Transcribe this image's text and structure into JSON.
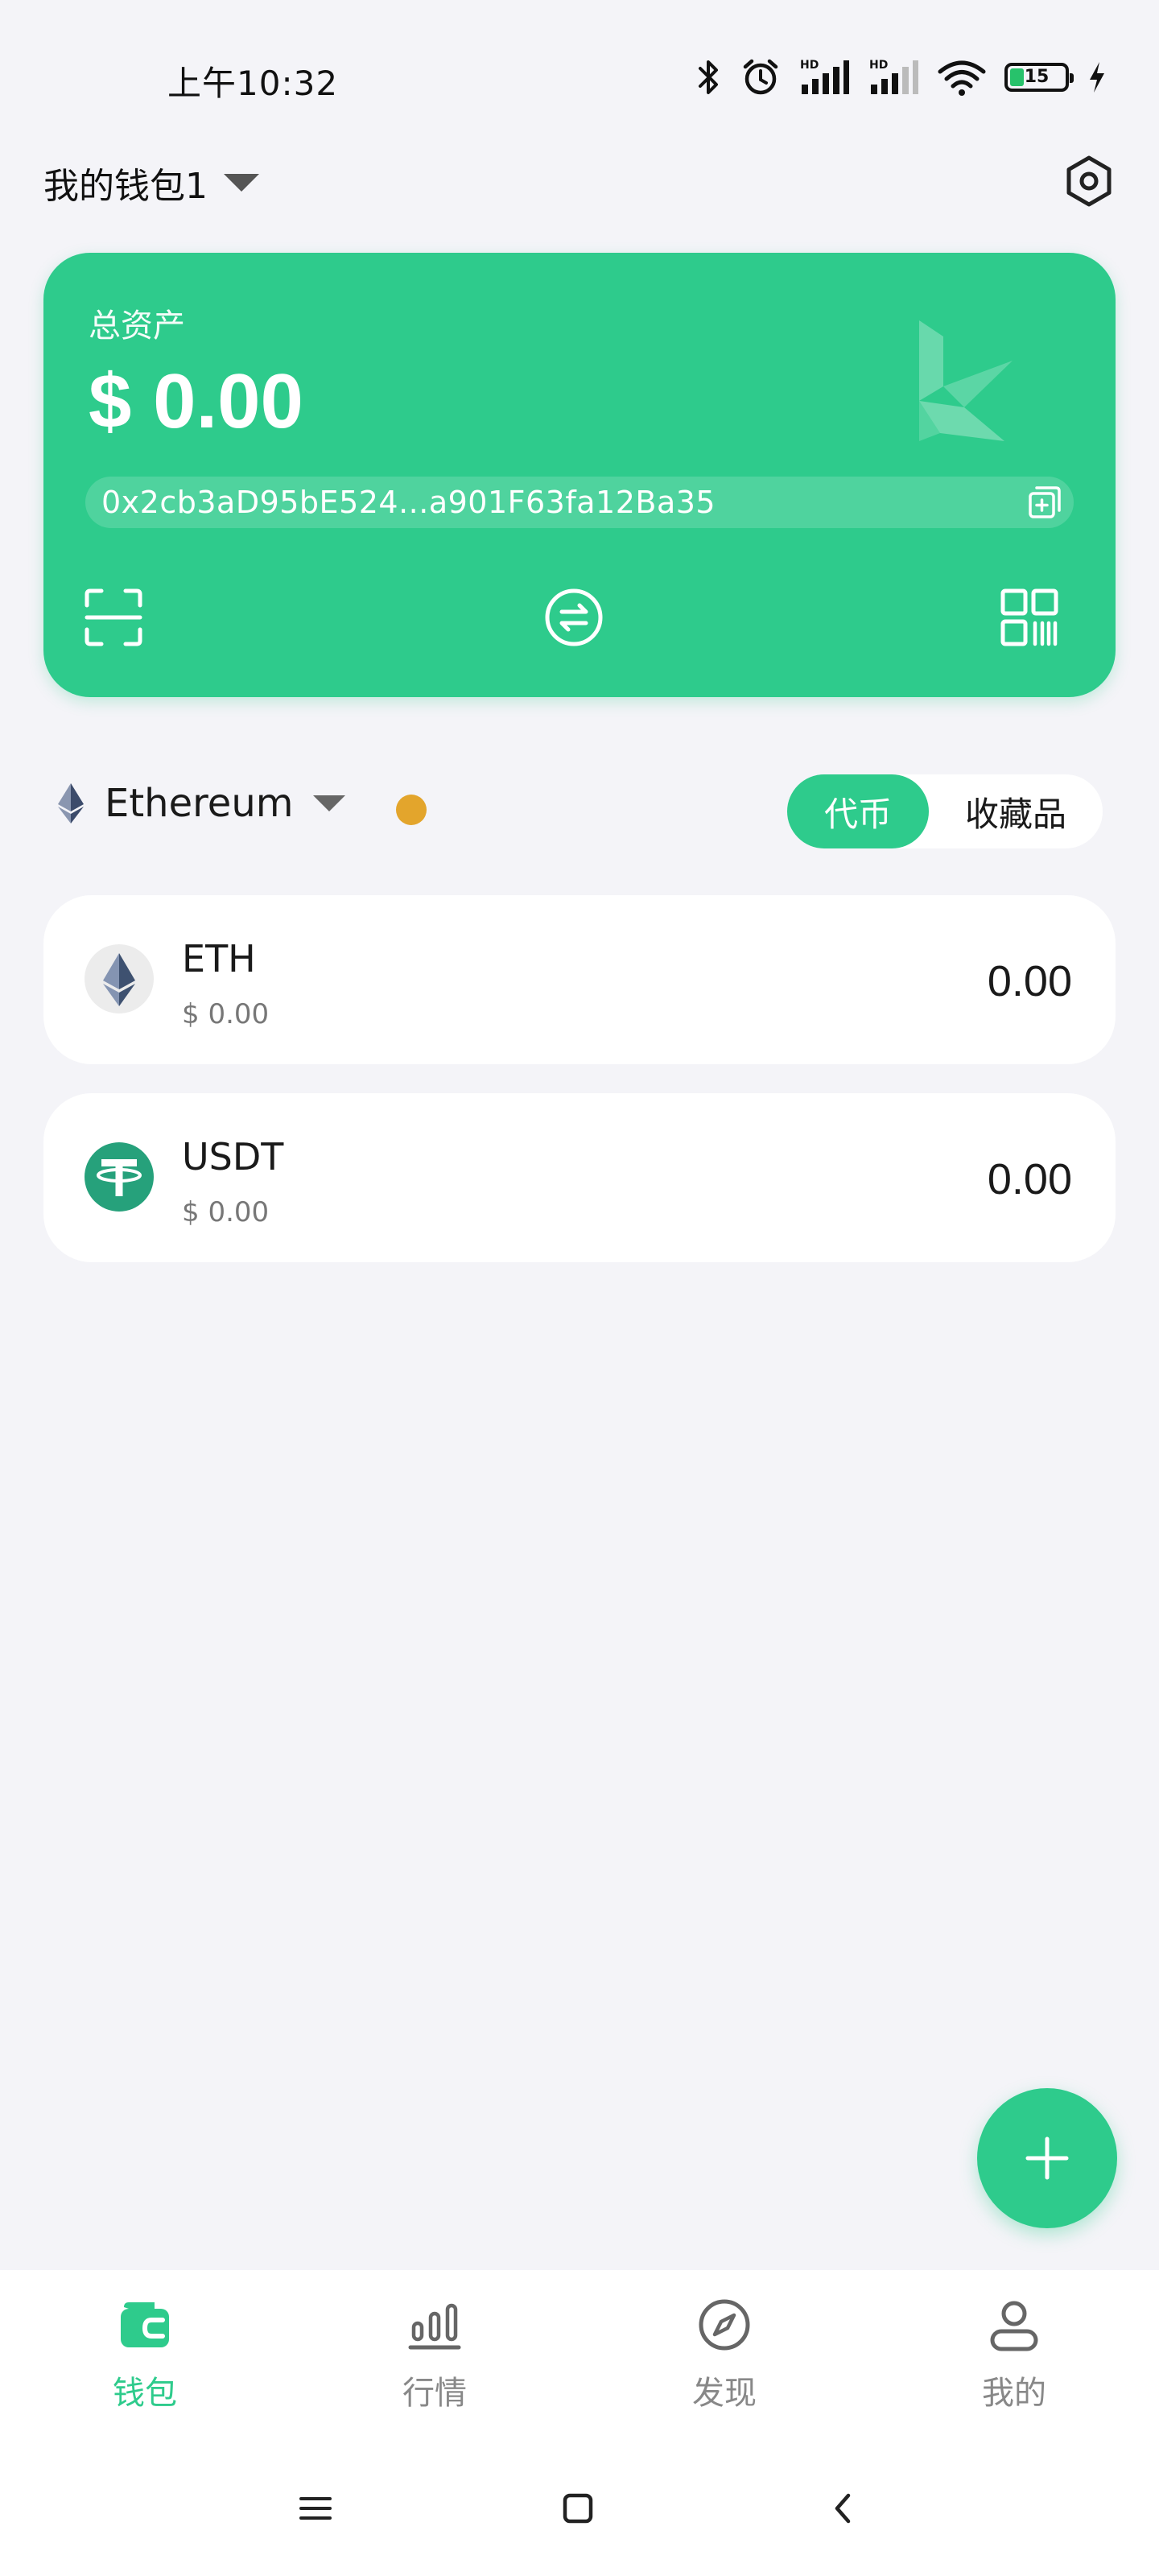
{
  "status_bar": {
    "time": "上午10:32",
    "battery": "15"
  },
  "header": {
    "wallet_name": "我的钱包1"
  },
  "card": {
    "total_assets_label": "总资产",
    "total_assets_value": "$ 0.00",
    "address": "0x2cb3aD95bE524...a901F63fa12Ba35",
    "color": "#2ecb8c"
  },
  "network": {
    "name": "Ethereum",
    "status_color": "#e3a52c"
  },
  "tabs": [
    {
      "label": "代币",
      "active": true
    },
    {
      "label": "收藏品",
      "active": false
    }
  ],
  "tokens": [
    {
      "symbol": "ETH",
      "fiat_value": "$ 0.00",
      "balance": "0.00",
      "icon": "ethereum-icon"
    },
    {
      "symbol": "USDT",
      "fiat_value": "$ 0.00",
      "balance": "0.00",
      "icon": "tether-icon"
    }
  ],
  "bottom_nav": [
    {
      "label": "钱包",
      "icon": "wallet-icon",
      "active": true
    },
    {
      "label": "行情",
      "icon": "chart-bars-icon",
      "active": false
    },
    {
      "label": "发现",
      "icon": "compass-icon",
      "active": false
    },
    {
      "label": "我的",
      "icon": "user-icon",
      "active": false
    }
  ]
}
